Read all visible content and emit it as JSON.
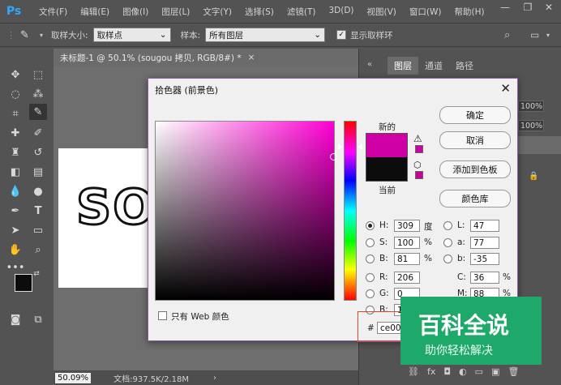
{
  "menubar": {
    "logo": "Ps",
    "items": [
      "文件(F)",
      "编辑(E)",
      "图像(I)",
      "图层(L)",
      "文字(Y)",
      "选择(S)",
      "滤镜(T)",
      "3D(D)",
      "视图(V)",
      "窗口(W)",
      "帮助(H)"
    ],
    "minimize": "—",
    "restore": "❐",
    "close": "✕"
  },
  "options": {
    "sample_size_label": "取样大小:",
    "sample_size_value": "取样点",
    "sample_label": "样本:",
    "sample_value": "所有图层",
    "show_ring_label": "显示取样环",
    "show_ring_checked": true
  },
  "document": {
    "tab_title": "未标题-1 @ 50.1% (sougou 拷贝, RGB/8#) *",
    "tab_close": "×",
    "canvas_text": "SO",
    "zoom": "50.09%",
    "doc_info": "文档:937.5K/2.18M"
  },
  "panels": {
    "tabs": [
      "图层",
      "通道",
      "路径"
    ],
    "opacity": "100%",
    "fill": "100%"
  },
  "color_picker": {
    "title": "拾色器 (前景色)",
    "new_label": "新的",
    "current_label": "当前",
    "new_color": "#ce00a5",
    "current_color": "#0d0c0d",
    "buttons": {
      "ok": "确定",
      "cancel": "取消",
      "add_to_swatches": "添加到色板",
      "color_libraries": "颜色库"
    },
    "hsb": {
      "h_label": "H:",
      "h": "309",
      "h_unit": "度",
      "s_label": "S:",
      "s": "100",
      "s_unit": "%",
      "b_label": "B:",
      "b": "81",
      "b_unit": "%"
    },
    "rgb": {
      "r_label": "R:",
      "r": "206",
      "g_label": "G:",
      "g": "0",
      "b_label": "B:",
      "b": "1"
    },
    "lab": {
      "l_label": "L:",
      "l": "47",
      "a_label": "a:",
      "a": "77",
      "b_label": "b:",
      "b": "-35"
    },
    "cmyk": {
      "c_label": "C:",
      "c": "36",
      "c_unit": "%",
      "m_label": "M:",
      "m": "88",
      "m_unit": "%"
    },
    "web_colors_label": "只有 Web 颜色",
    "hex_prefix": "#",
    "hex": "ce00a"
  },
  "watermark": {
    "main": "百科全说",
    "sub": "助你轻松解决"
  }
}
